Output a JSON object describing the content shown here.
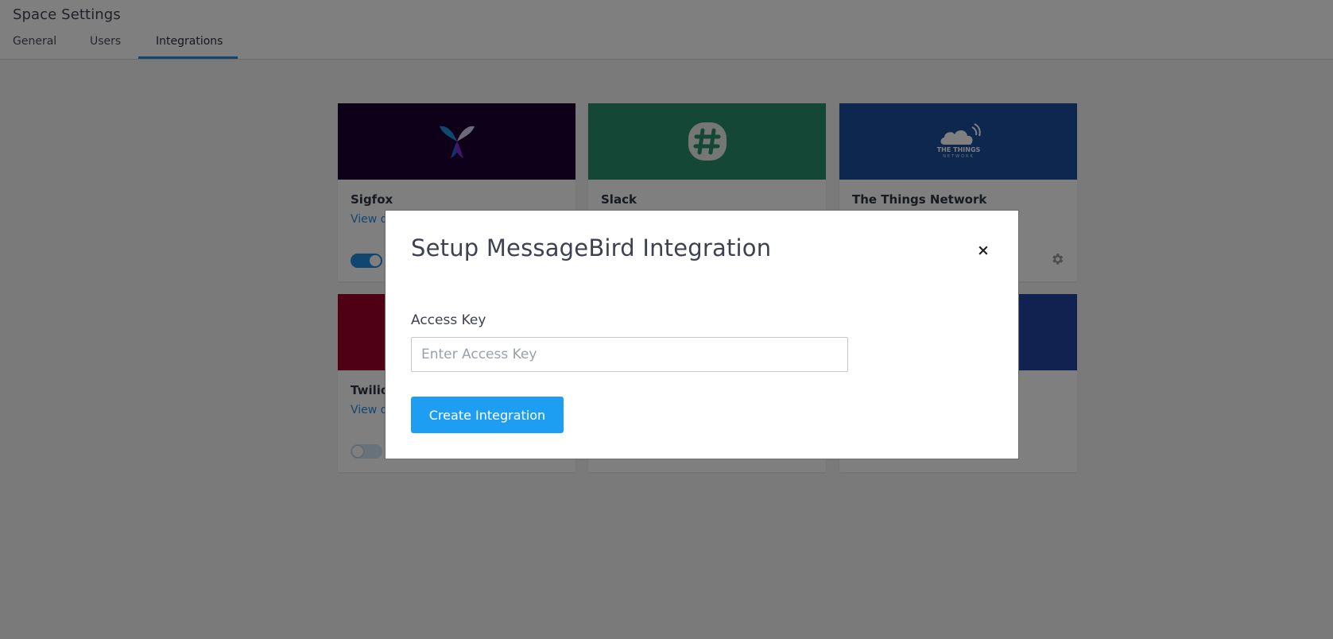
{
  "header": {
    "title": "Space Settings",
    "tabs": [
      {
        "label": "General"
      },
      {
        "label": "Users"
      },
      {
        "label": "Integrations",
        "active": true
      }
    ]
  },
  "cards": [
    {
      "name": "Sigfox",
      "link": "View d",
      "banner_color": "#1e0035",
      "icon": "sigfox-logo-icon",
      "toggle": "on"
    },
    {
      "name": "Slack",
      "banner_color": "#2a8f6f",
      "icon": "slack-hash-icon"
    },
    {
      "name": "The Things Network",
      "banner_color": "#1c4e9f",
      "icon": "cloud-logo-icon",
      "logo_text": "THE THINGS",
      "logo_subtext": "NETWORK",
      "settings_icon": "gear-icon"
    },
    {
      "name": "Twilio",
      "link": "View d",
      "banner_color": "#a0002a",
      "toggle": "off"
    },
    {
      "banner_color": "#ffffff"
    },
    {
      "banner_color": "#2344a0"
    }
  ],
  "modal": {
    "title": "Setup MessageBird Integration",
    "close_label": "×",
    "field_label": "Access Key",
    "field_placeholder": "Enter Access Key",
    "field_value": "",
    "submit_label": "Create Integration"
  },
  "colors": {
    "accent": "#1f8fe0",
    "button": "#1e9ef2",
    "overlay": "rgba(0,0,0,0.5)"
  }
}
